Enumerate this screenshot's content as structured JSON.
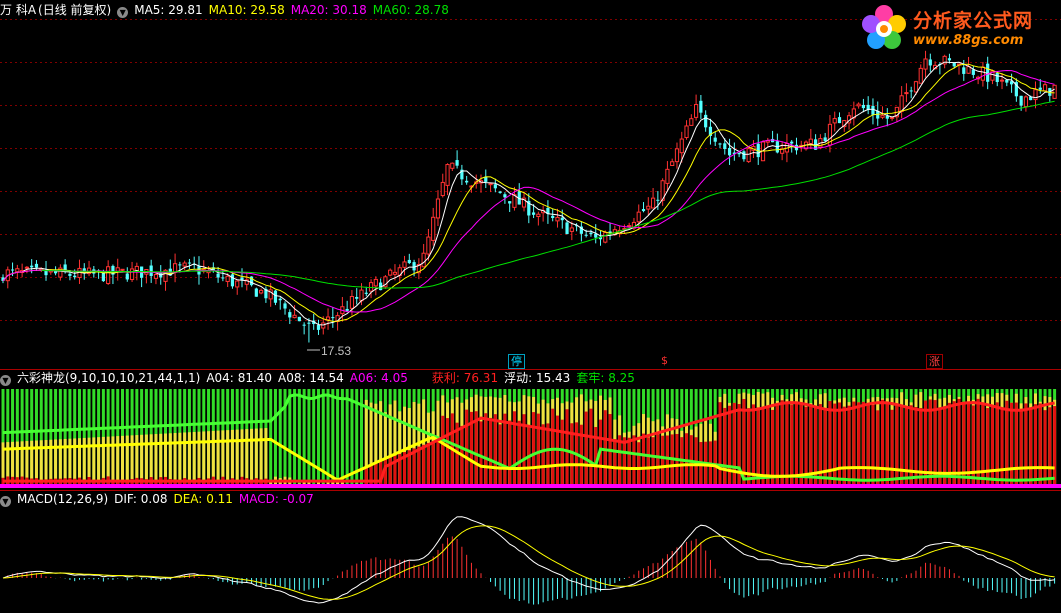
{
  "panel1": {
    "stock_name": "万 科A",
    "period": "(日线 前复权)",
    "ma5": {
      "label": "MA5:",
      "value": "29.81",
      "color": "#ffffff"
    },
    "ma10": {
      "label": "MA10:",
      "value": "29.58",
      "color": "#ffff00"
    },
    "ma20": {
      "label": "MA20:",
      "value": "30.18",
      "color": "#ff00ff"
    },
    "ma60": {
      "label": "MA60:",
      "value": "28.78",
      "color": "#00e000"
    },
    "low_annotation": "17.53",
    "markers": [
      {
        "text": "停",
        "color": "#00d8ff"
      },
      {
        "text": "$",
        "color": "#ff3030"
      },
      {
        "text": "涨",
        "color": "#ff4040"
      }
    ]
  },
  "panel2": {
    "name": "六彩神龙(9,10,10,10,21,44,1,1)",
    "a04": {
      "label": "A04:",
      "value": "81.40"
    },
    "a08": {
      "label": "A08:",
      "value": "14.54"
    },
    "a06": {
      "label": "A06:",
      "value": "4.05"
    },
    "profit": {
      "label": "获利:",
      "value": "76.31"
    },
    "float": {
      "label": "浮动:",
      "value": "15.43"
    },
    "trapped": {
      "label": "套牢:",
      "value": "8.25"
    }
  },
  "panel3": {
    "name": "MACD(12,26,9)",
    "dif": {
      "label": "DIF:",
      "value": "0.08"
    },
    "dea": {
      "label": "DEA:",
      "value": "0.11"
    },
    "macd": {
      "label": "MACD:",
      "value": "-0.07"
    }
  },
  "logo": {
    "title": "分析家公式网",
    "url": "www.88gs.com"
  },
  "chart_data": {
    "type": "candlestick",
    "price_range": [
      16.5,
      36.5
    ],
    "low_marker": 17.53,
    "ma_final": {
      "MA5": 29.81,
      "MA10": 29.58,
      "MA20": 30.18,
      "MA60": 28.78
    },
    "close_keypoints": [
      [
        0,
        21.6
      ],
      [
        20,
        21.5
      ],
      [
        40,
        21.9
      ],
      [
        55,
        20.4
      ],
      [
        65,
        18.2
      ],
      [
        78,
        20.9
      ],
      [
        88,
        22.5
      ],
      [
        93,
        27.8
      ],
      [
        105,
        26.2
      ],
      [
        114,
        24.8
      ],
      [
        124,
        23.6
      ],
      [
        136,
        25.6
      ],
      [
        145,
        31.2
      ],
      [
        152,
        28.6
      ],
      [
        163,
        29.1
      ],
      [
        170,
        29.2
      ],
      [
        178,
        31.5
      ],
      [
        186,
        30.6
      ],
      [
        193,
        34.3
      ],
      [
        200,
        33.8
      ],
      [
        207,
        33.1
      ],
      [
        213,
        31.9
      ],
      [
        220,
        32.5
      ]
    ]
  }
}
